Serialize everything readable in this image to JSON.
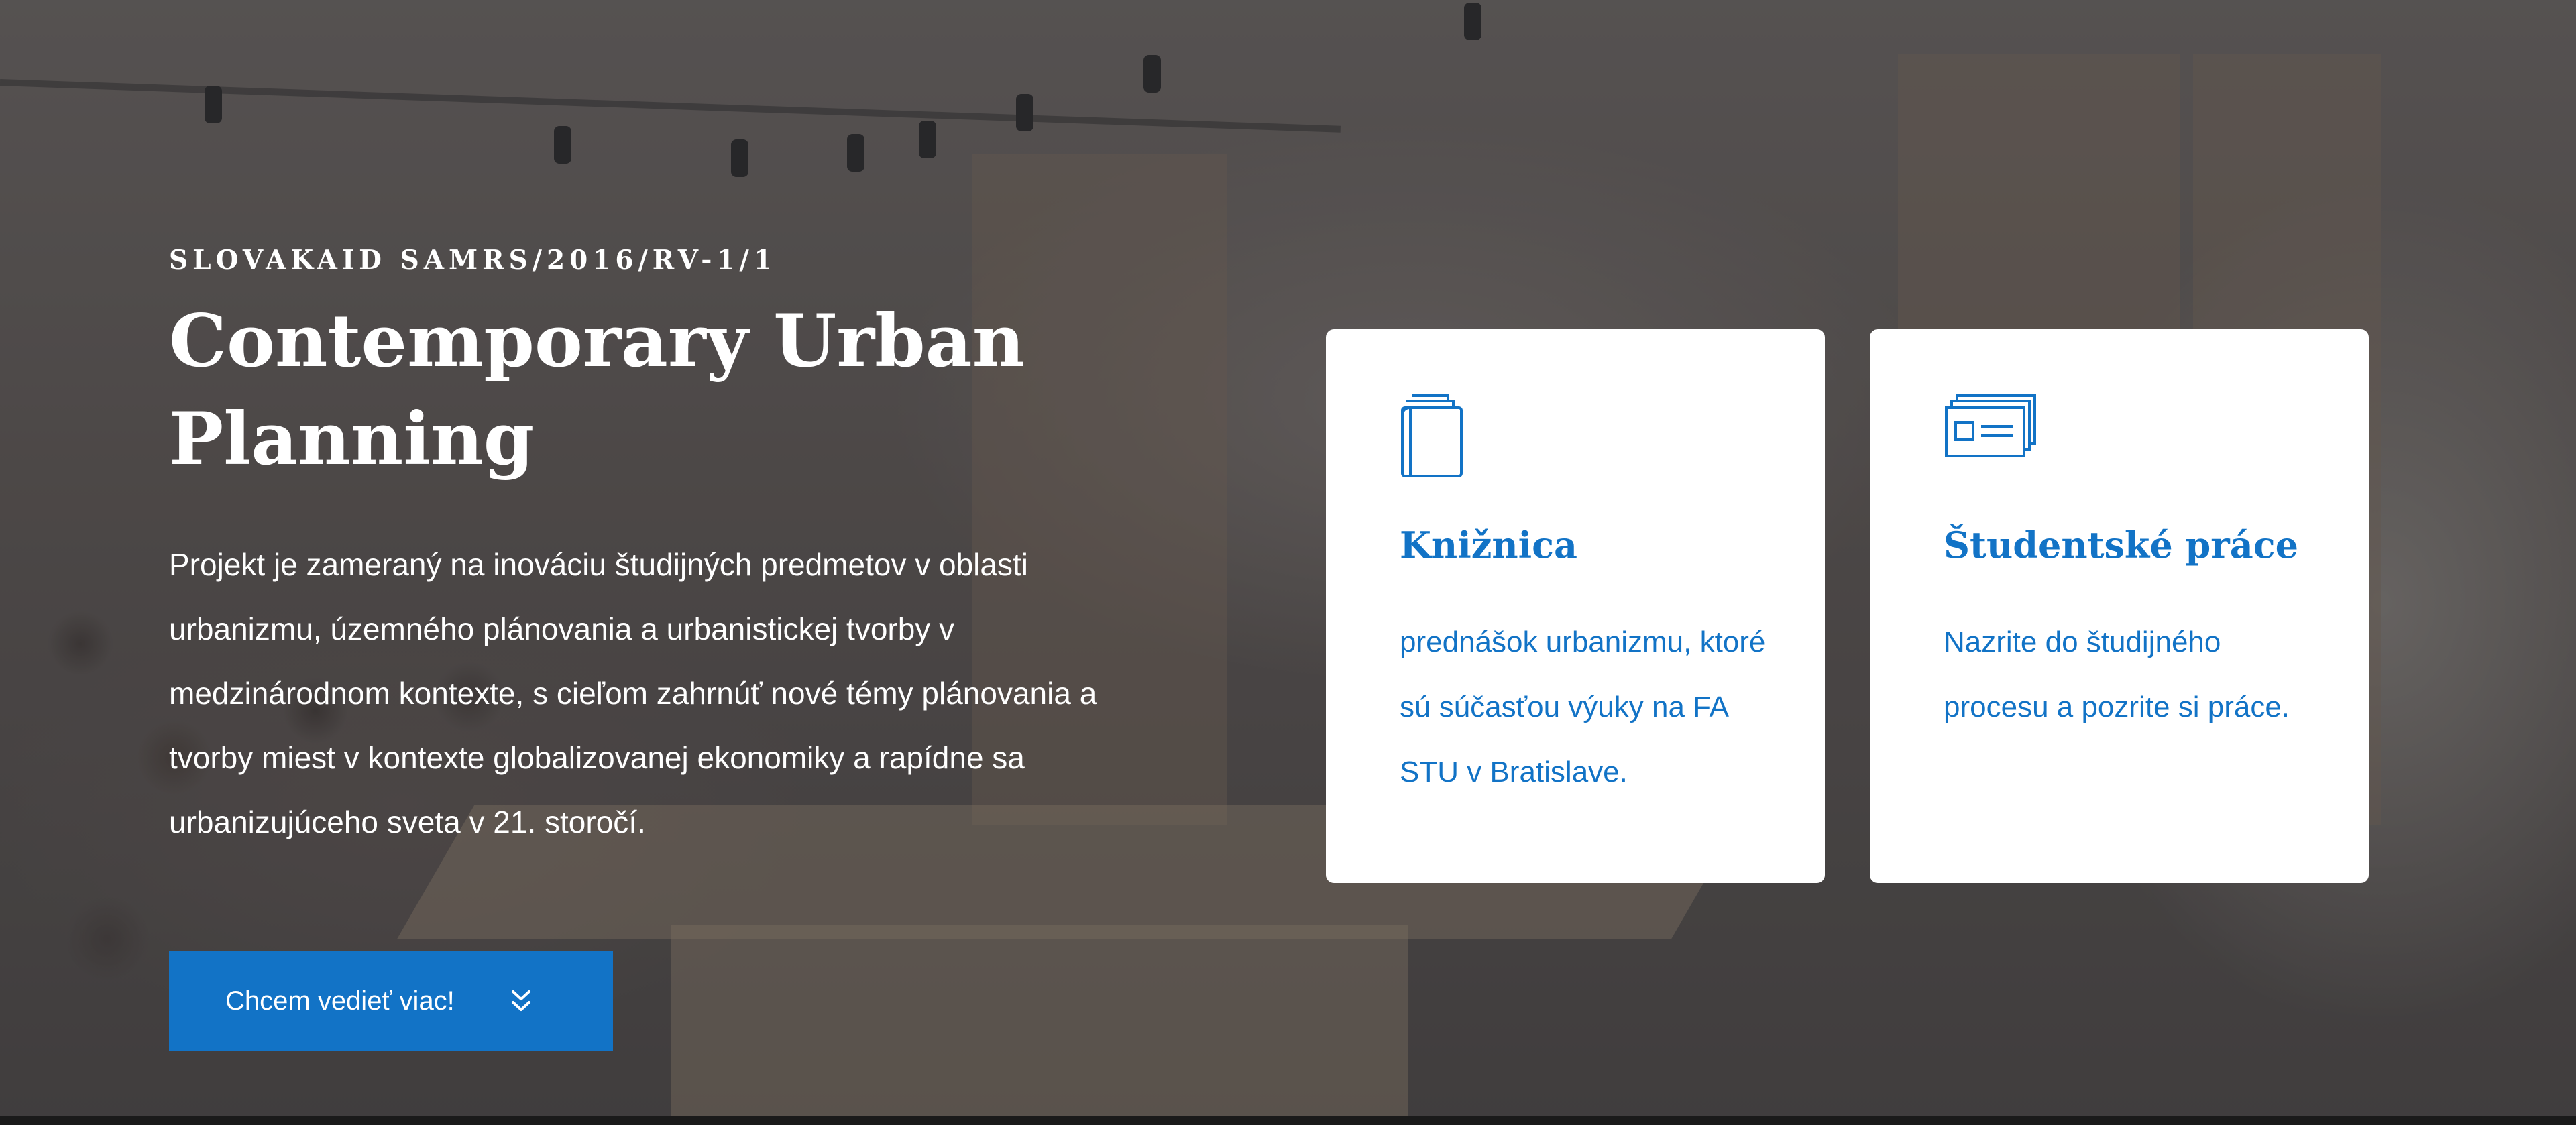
{
  "hero": {
    "eyebrow": "SLOVAKAID SAMRS/2016/RV-1/1",
    "title": "Contemporary Urban Planning",
    "description": "Projekt je zameraný na inováciu študijných predmetov v oblasti urbanizmu, územného plánovania a urbanistickej tvorby v medzinárodnom kontexte, s cieľom zahrnúť nové témy plánovania a tvorby miest v kontexte globalizovanej ekonomiky a rapídne sa urbanizujúceho sveta v 21. storočí.",
    "cta_label": "Chcem vedieť viac!",
    "cta_icon": "double-chevron-down-icon"
  },
  "cards": [
    {
      "icon": "book-stack-icon",
      "title": "Knižnica",
      "text": "prednášok urbanizmu, ktoré sú súčasťou výuky na FA STU v Bratislave."
    },
    {
      "icon": "id-cards-icon",
      "title": "Študentské práce",
      "text": "Nazrite do študijného procesu a pozrite si práce."
    }
  ],
  "colors": {
    "accent": "#1273c6",
    "card_background": "#ffffff",
    "hero_text": "#ffffff"
  }
}
